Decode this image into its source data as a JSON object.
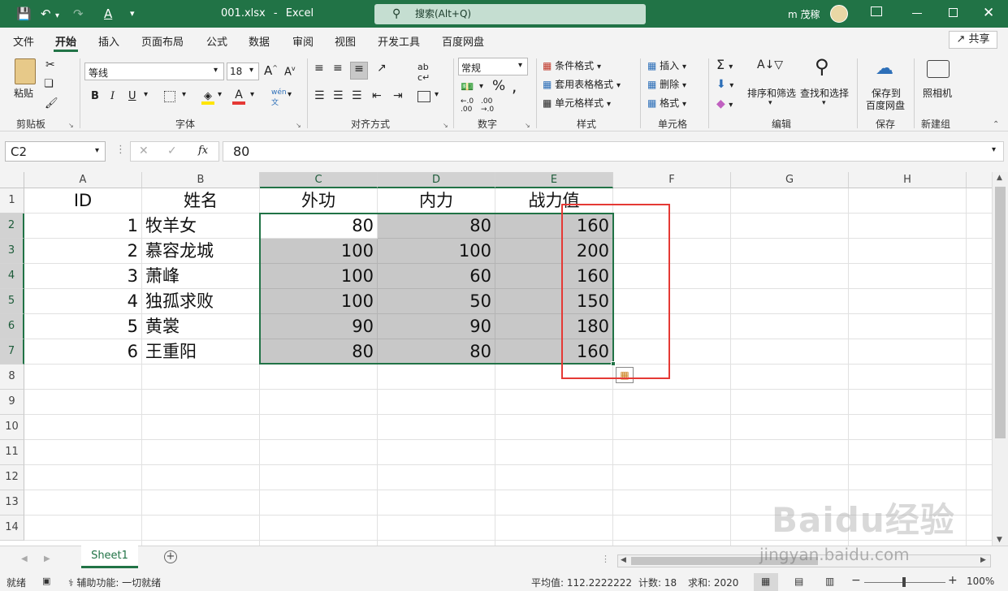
{
  "titlebar": {
    "filename": "001.xlsx",
    "sep": "-",
    "app": "Excel",
    "search_placeholder": "搜索(Alt+Q)",
    "user": "m 茂稼"
  },
  "menu": {
    "tabs": [
      "文件",
      "开始",
      "插入",
      "页面布局",
      "公式",
      "数据",
      "审阅",
      "视图",
      "开发工具",
      "百度网盘"
    ],
    "active": "开始",
    "share": "共享"
  },
  "ribbon": {
    "paste": "粘贴",
    "font_name": "等线",
    "font_size": "18",
    "number_format": "常规",
    "cond_format": "条件格式",
    "table_format": "套用表格格式",
    "cell_style": "单元格样式",
    "insert": "插入",
    "delete": "删除",
    "format": "格式",
    "sort_filter": "排序和筛选",
    "find_select": "查找和选择",
    "save_to": "保存到",
    "baidu_disk": "百度网盘",
    "camera": "照相机",
    "groups": [
      "剪贴板",
      "字体",
      "对齐方式",
      "数字",
      "样式",
      "单元格",
      "编辑",
      "保存",
      "新建组"
    ]
  },
  "formula": {
    "name_box": "C2",
    "fx": "fx",
    "value": "80"
  },
  "columns": [
    "A",
    "B",
    "C",
    "D",
    "E",
    "F",
    "G",
    "H"
  ],
  "rows": [
    "1",
    "2",
    "3",
    "4",
    "5",
    "6",
    "7",
    "8",
    "9",
    "10",
    "11",
    "12",
    "13",
    "14"
  ],
  "cells": {
    "header": [
      "ID",
      "姓名",
      "外功",
      "内力",
      "战力值"
    ],
    "data": [
      [
        "1",
        "牧羊女",
        "80",
        "80",
        "160"
      ],
      [
        "2",
        "慕容龙城",
        "100",
        "100",
        "200"
      ],
      [
        "3",
        "萧峰",
        "100",
        "60",
        "160"
      ],
      [
        "4",
        "独孤求败",
        "100",
        "50",
        "150"
      ],
      [
        "5",
        "黄裳",
        "90",
        "90",
        "180"
      ],
      [
        "6",
        "王重阳",
        "80",
        "80",
        "160"
      ]
    ]
  },
  "sheet": {
    "tab": "Sheet1"
  },
  "status": {
    "ready": "就绪",
    "accessibility": "辅助功能: 一切就绪",
    "average": "平均值: 112.2222222",
    "count": "计数: 18",
    "sum": "求和: 2020",
    "zoom": "100%"
  },
  "watermark": {
    "brand": "Baidu经验",
    "url": "jingyan.baidu.com"
  },
  "colors": {
    "accent": "#217346",
    "highlight": "#e53935",
    "selection": "#c8c8c8"
  }
}
